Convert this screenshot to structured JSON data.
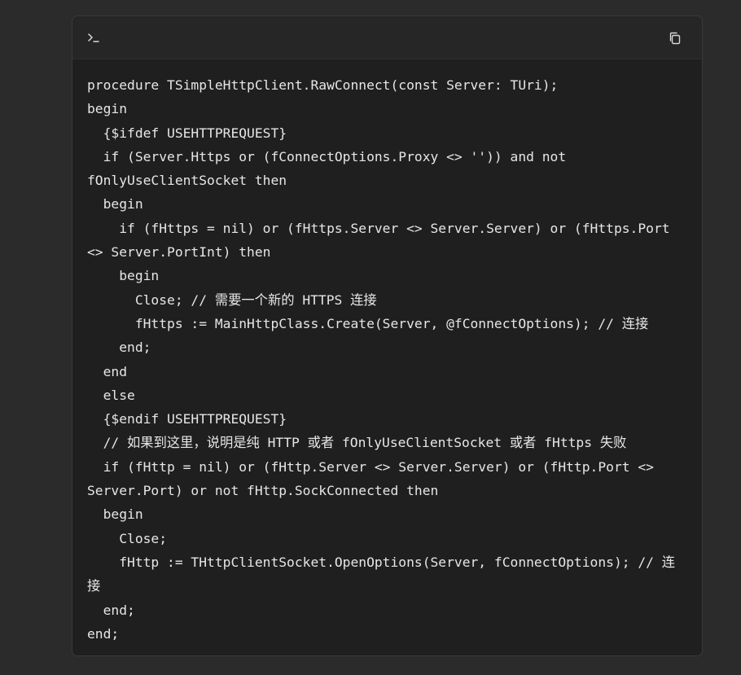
{
  "code_block": {
    "header_icon": "terminal-prompt-icon",
    "copy_icon": "copy-icon",
    "lines": [
      "procedure TSimpleHttpClient.RawConnect(const Server: TUri);",
      "begin",
      "  {$ifdef USEHTTPREQUEST}",
      "  if (Server.Https or (fConnectOptions.Proxy <> '')) and not",
      "fOnlyUseClientSocket then",
      "  begin",
      "    if (fHttps = nil) or (fHttps.Server <> Server.Server) or (fHttps.Port",
      "<> Server.PortInt) then",
      "    begin",
      "      Close; // 需要一个新的 HTTPS 连接",
      "      fHttps := MainHttpClass.Create(Server, @fConnectOptions); // 连接",
      "    end;",
      "  end",
      "  else",
      "  {$endif USEHTTPREQUEST}",
      "  // 如果到这里，说明是纯 HTTP 或者 fOnlyUseClientSocket 或者 fHttps 失败",
      "  if (fHttp = nil) or (fHttp.Server <> Server.Server) or (fHttp.Port <>",
      "Server.Port) or not fHttp.SockConnected then",
      "  begin",
      "    Close;",
      "    fHttp := THttpClientSocket.OpenOptions(Server, fConnectOptions); // 连",
      "接",
      "  end;",
      "end;"
    ]
  }
}
